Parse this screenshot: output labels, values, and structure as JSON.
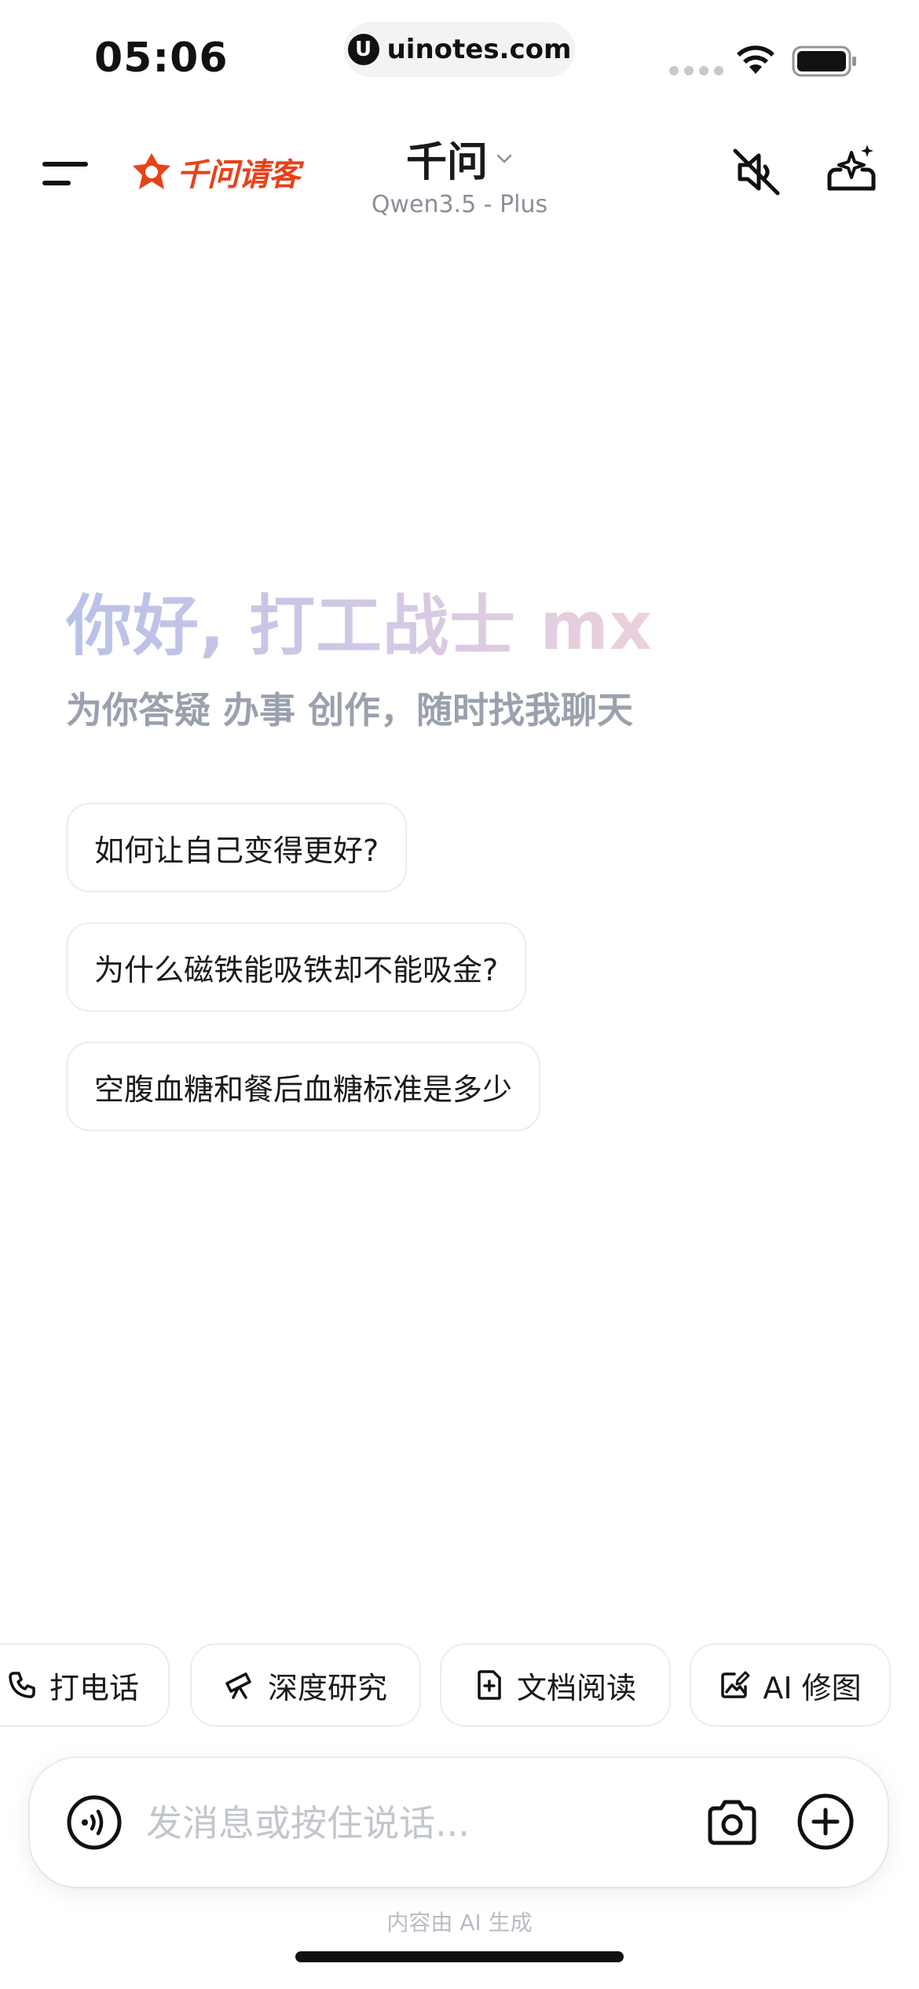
{
  "status_bar": {
    "time": "05:06",
    "url_icon_glyph": "U",
    "url": "uinotes.com",
    "icons": [
      "signal-dots-icon",
      "wifi-icon",
      "battery-icon"
    ]
  },
  "header": {
    "menu_icon": "menu-icon",
    "brand_logo_text": "千问请客",
    "brand_color": "#e8421a",
    "model_name": "千问",
    "model_version": "Qwen3.5 - Plus",
    "mute_icon": "speaker-muted-icon",
    "new_chat_icon": "sparkle-new-chat-icon"
  },
  "greeting": {
    "title": "你好, 打工战士 mx",
    "subtitle": "为你答疑 办事 创作，随时找我聊天"
  },
  "suggestions": [
    "如何让自己变得更好?",
    "为什么磁铁能吸铁却不能吸金?",
    "空腹血糖和餐后血糖标准是多少"
  ],
  "tools": [
    {
      "label": "打电话",
      "icon": "phone-icon"
    },
    {
      "label": "深度研究",
      "icon": "telescope-icon"
    },
    {
      "label": "文档阅读",
      "icon": "document-plus-icon"
    },
    {
      "label": "AI 修图",
      "icon": "image-edit-icon"
    }
  ],
  "composer": {
    "placeholder": "发消息或按住说话...",
    "voice_icon": "voice-wave-icon",
    "camera_icon": "camera-icon",
    "plus_icon": "plus-circle-icon"
  },
  "footer": {
    "disclaimer": "内容由 AI 生成"
  }
}
